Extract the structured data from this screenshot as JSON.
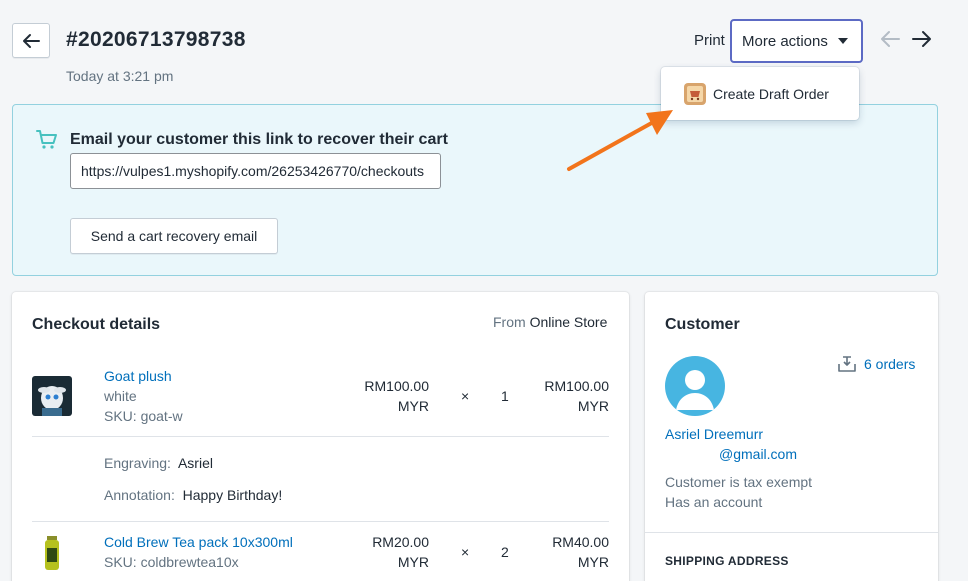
{
  "header": {
    "order_number": "#20206713798738",
    "timestamp": "Today at 3:21 pm",
    "print_label": "Print",
    "more_actions_label": "More actions"
  },
  "dropdown": {
    "items": [
      {
        "label": "Create Draft Order",
        "icon": "draft-order-app-icon"
      }
    ]
  },
  "recovery": {
    "title": "Email your customer this link to recover their cart",
    "url_value": "https://vulpes1.myshopify.com/26253426770/checkouts",
    "button_label": "Send a cart recovery email"
  },
  "checkout": {
    "title": "Checkout details",
    "from_prefix": "From",
    "from_source": "Online Store",
    "items": [
      {
        "name": "Goat plush",
        "variant": "white",
        "sku": "SKU: goat-w",
        "unit_price": "RM100.00",
        "unit_currency": "MYR",
        "times": "×",
        "quantity": "1",
        "total_price": "RM100.00",
        "total_currency": "MYR",
        "properties": [
          {
            "key": "Engraving:",
            "value": "Asriel"
          },
          {
            "key": "Annotation:",
            "value": "Happy Birthday!"
          }
        ]
      },
      {
        "name": "Cold Brew Tea pack 10x300ml",
        "sku": "SKU: coldbrewtea10x",
        "unit_price": "RM20.00",
        "unit_currency": "MYR",
        "times": "×",
        "quantity": "2",
        "total_price": "RM40.00",
        "total_currency": "MYR"
      }
    ]
  },
  "customer": {
    "title": "Customer",
    "orders_link": "6 orders",
    "name": "Asriel Dreemurr",
    "email": "@gmail.com",
    "tax_status": "Customer is tax exempt",
    "account_status": "Has an account",
    "shipping_title": "SHIPPING ADDRESS"
  },
  "colors": {
    "accent": "#5c6ac4",
    "link": "#006fbb",
    "banner_bg": "#eaf7fb",
    "banner_border": "#93d1df",
    "annotation_arrow": "#f2741b",
    "avatar": "#47b5e1"
  }
}
